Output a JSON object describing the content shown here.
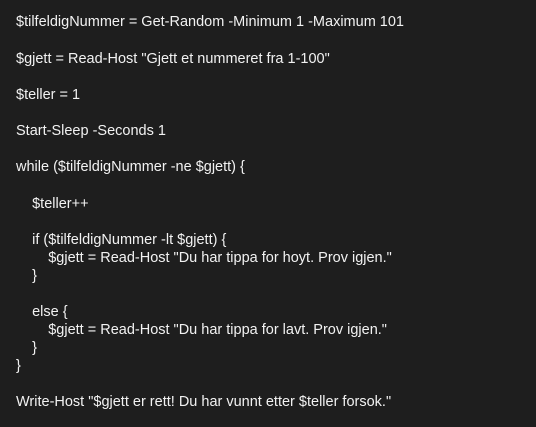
{
  "code": {
    "lines": [
      "$tilfeldigNummer = Get-Random -Minimum 1 -Maximum 101",
      "$gjett = Read-Host \"Gjett et nummeret fra 1-100\"",
      "$teller = 1",
      "Start-Sleep -Seconds 1",
      "while ($tilfeldigNummer -ne $gjett) {",
      "    $teller++",
      "    if ($tilfeldigNummer -lt $gjett) {",
      "        $gjett = Read-Host \"Du har tippa for hoyt. Prov igjen.\"",
      "    }",
      "    else {",
      "        $gjett = Read-Host \"Du har tippa for lavt. Prov igjen.\"",
      "    }",
      "}",
      "Write-Host \"$gjett er rett! Du har vunnt etter $teller forsok.\""
    ]
  }
}
